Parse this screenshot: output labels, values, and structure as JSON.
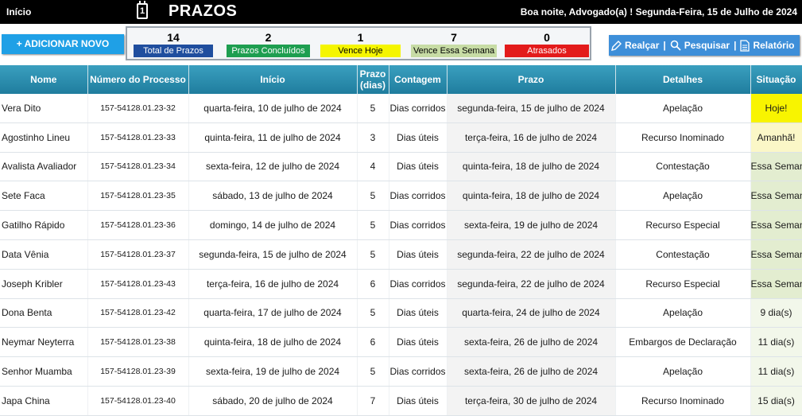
{
  "topbar": {
    "inicio": "Início",
    "calendar_day": "1",
    "title": "PRAZOS",
    "greeting": "Boa noite, Advogado(a) ! Segunda-Feira, 15 de Julho de 2024"
  },
  "toolbar": {
    "add_label": "+ ADICIONAR NOVO",
    "realcar": "Realçar",
    "pesquisar": "Pesquisar",
    "relatorio": "Relatório",
    "separator": "|"
  },
  "summary": [
    {
      "value": "14",
      "label": "Total de Prazos"
    },
    {
      "value": "2",
      "label": "Prazos Concluídos"
    },
    {
      "value": "1",
      "label": "Vence Hoje"
    },
    {
      "value": "7",
      "label": "Vence Essa Semana"
    },
    {
      "value": "0",
      "label": "Atrasados"
    }
  ],
  "table": {
    "headers": {
      "nome": "Nome",
      "processo": "Número do Processo",
      "inicio": "Início",
      "prazo_dias_1": "Prazo",
      "prazo_dias_2": "(dias)",
      "contagem": "Contagem",
      "prazo": "Prazo",
      "detalhes": "Detalhes",
      "situacao": "Situação"
    },
    "rows": [
      {
        "nome": "Vera Dito",
        "processo": "157-54128.01.23-32",
        "inicio": "quarta-feira, 10 de julho de 2024",
        "dias": "5",
        "contagem": "Dias corridos",
        "prazo": "segunda-feira, 15 de julho de 2024",
        "detalhes": "Apelação",
        "situacao": "Hoje!"
      },
      {
        "nome": "Agostinho Lineu",
        "processo": "157-54128.01.23-33",
        "inicio": "quinta-feira, 11 de julho de 2024",
        "dias": "3",
        "contagem": "Dias úteis",
        "prazo": "terça-feira, 16 de julho de 2024",
        "detalhes": "Recurso Inominado",
        "situacao": "Amanhã!"
      },
      {
        "nome": "Avalista Avaliador",
        "processo": "157-54128.01.23-34",
        "inicio": "sexta-feira, 12 de julho de 2024",
        "dias": "4",
        "contagem": "Dias úteis",
        "prazo": "quinta-feira, 18 de julho de 2024",
        "detalhes": "Contestação",
        "situacao": "Essa Semana"
      },
      {
        "nome": "Sete Faca",
        "processo": "157-54128.01.23-35",
        "inicio": "sábado, 13 de julho de 2024",
        "dias": "5",
        "contagem": "Dias corridos",
        "prazo": "quinta-feira, 18 de julho de 2024",
        "detalhes": "Apelação",
        "situacao": "Essa Semana"
      },
      {
        "nome": "Gatilho Rápido",
        "processo": "157-54128.01.23-36",
        "inicio": "domingo, 14 de julho de 2024",
        "dias": "5",
        "contagem": "Dias corridos",
        "prazo": "sexta-feira, 19 de julho de 2024",
        "detalhes": "Recurso Especial",
        "situacao": "Essa Semana"
      },
      {
        "nome": "Data Vênia",
        "processo": "157-54128.01.23-37",
        "inicio": "segunda-feira, 15 de julho de 2024",
        "dias": "5",
        "contagem": "Dias úteis",
        "prazo": "segunda-feira, 22 de julho de 2024",
        "detalhes": "Contestação",
        "situacao": "Essa Semana"
      },
      {
        "nome": "Joseph Kribler",
        "processo": "157-54128.01.23-43",
        "inicio": "terça-feira, 16 de julho de 2024",
        "dias": "6",
        "contagem": "Dias corridos",
        "prazo": "segunda-feira, 22 de julho de 2024",
        "detalhes": "Recurso Especial",
        "situacao": "Essa Semana"
      },
      {
        "nome": "Dona Benta",
        "processo": "157-54128.01.23-42",
        "inicio": "quarta-feira, 17 de julho de 2024",
        "dias": "5",
        "contagem": "Dias úteis",
        "prazo": "quarta-feira, 24 de julho de 2024",
        "detalhes": "Apelação",
        "situacao": "9 dia(s)"
      },
      {
        "nome": "Neymar Neyterra",
        "processo": "157-54128.01.23-38",
        "inicio": "quinta-feira, 18 de julho de 2024",
        "dias": "6",
        "contagem": "Dias úteis",
        "prazo": "sexta-feira, 26 de julho de 2024",
        "detalhes": "Embargos de Declaração",
        "situacao": "11 dia(s)"
      },
      {
        "nome": "Senhor Muamba",
        "processo": "157-54128.01.23-39",
        "inicio": "sexta-feira, 19 de julho de 2024",
        "dias": "5",
        "contagem": "Dias corridos",
        "prazo": "sexta-feira, 26 de julho de 2024",
        "detalhes": "Apelação",
        "situacao": "11 dia(s)"
      },
      {
        "nome": "Japa China",
        "processo": "157-54128.01.23-40",
        "inicio": "sábado, 20 de julho de 2024",
        "dias": "7",
        "contagem": "Dias úteis",
        "prazo": "terça-feira, 30 de julho de 2024",
        "detalhes": "Recurso Inominado",
        "situacao": "15 dia(s)"
      }
    ]
  },
  "colors": {
    "header_teal": "#2a8fb0",
    "hoje": "#f8f400",
    "amanha": "#fbf7c7",
    "semana": "#e3edd0"
  }
}
